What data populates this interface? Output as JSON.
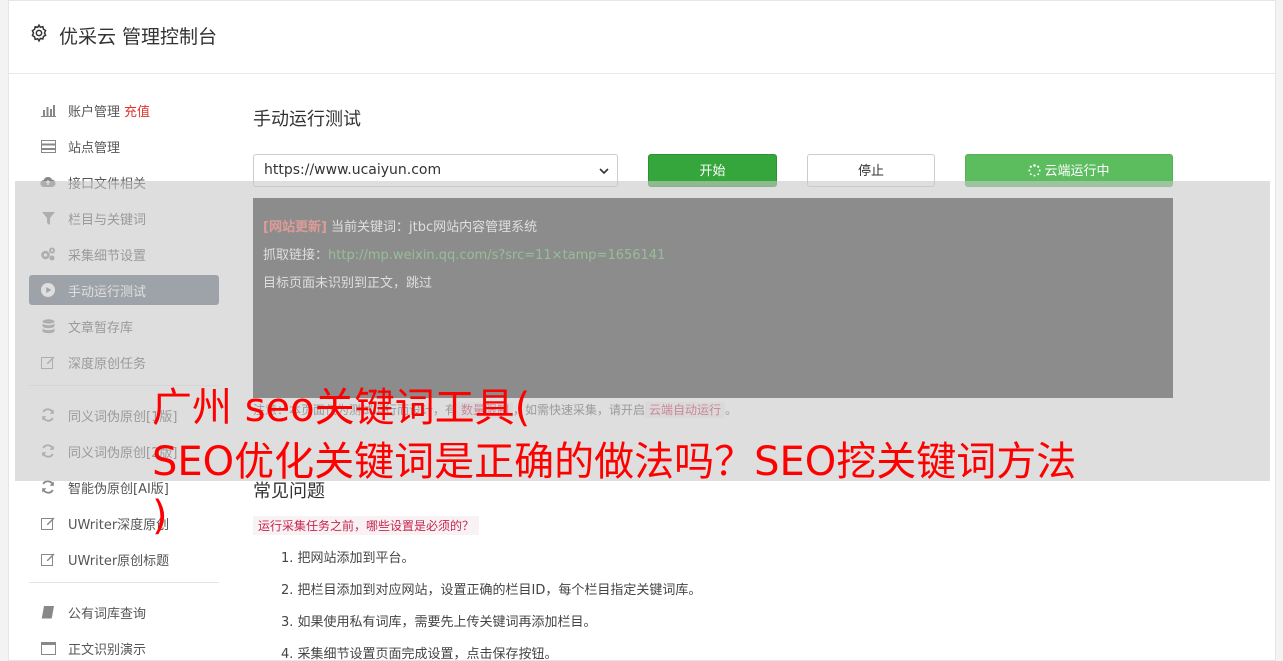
{
  "header": {
    "title": "优采云 管理控制台",
    "icon": "gear-icon"
  },
  "sidebar": {
    "group1": [
      {
        "label": "账户管理",
        "badge": "充值",
        "icon": "bar-chart-icon"
      },
      {
        "label": "站点管理",
        "icon": "server-icon"
      },
      {
        "label": "接口文件相关",
        "icon": "cloud-upload-icon"
      },
      {
        "label": "栏目与关键词",
        "icon": "filter-icon"
      },
      {
        "label": "采集细节设置",
        "icon": "cogs-icon"
      },
      {
        "label": "手动运行测试",
        "icon": "play-circle-icon",
        "active": true
      },
      {
        "label": "文章暂存库",
        "icon": "database-icon"
      },
      {
        "label": "深度原创任务",
        "icon": "edit-icon"
      }
    ],
    "group2": [
      {
        "label": "同义词伪原创[1版]",
        "icon": "refresh-icon"
      },
      {
        "label": "同义词伪原创[2版]",
        "icon": "refresh-icon"
      },
      {
        "label": "智能伪原创[AI版]",
        "icon": "refresh-icon"
      },
      {
        "label": "UWriter深度原创",
        "icon": "edit-icon"
      },
      {
        "label": "UWriter原创标题",
        "icon": "edit-icon"
      }
    ],
    "group3": [
      {
        "label": "公有词库查询",
        "icon": "book-icon"
      },
      {
        "label": "正文识别演示",
        "icon": "window-icon"
      }
    ]
  },
  "main": {
    "title": "手动运行测试",
    "url_value": "https://www.ucaiyun.com",
    "start_label": "开始",
    "stop_label": "停止",
    "cloud_label": "云端运行中",
    "console": {
      "tag": "[网站更新]",
      "keyword_line": "当前关键词：jtbc网站内容管理系统",
      "fetch_label": "抓取链接：",
      "fetch_url": "http://mp.weixin.qq.com/s?src=11×tamp=1656141",
      "result_line": "目标页面未识别到正文，跳过"
    },
    "note": {
      "prefix": "注意：本页面仅为测试运行而设计，有",
      "code1": "数量限制",
      "middle": "，如需快速采集，请开启",
      "code2": "云端自动运行",
      "suffix": "。"
    },
    "faq": {
      "title": "常见问题",
      "question": "运行采集任务之前，哪些设置是必须的？",
      "items": [
        "1. 把网站添加到平台。",
        "2. 把栏目添加到对应网站，设置正确的栏目ID，每个栏目指定关键词库。",
        "3. 如果使用私有词库，需要先上传关键词再添加栏目。",
        "4. 采集细节设置页面完成设置，点击保存按钮。"
      ]
    }
  },
  "overlay": {
    "line1": "广州 seo关键词工具(",
    "line2": "SEO优化关键词是正确的做法吗？SEO挖关键词方法",
    "line3": ")"
  }
}
